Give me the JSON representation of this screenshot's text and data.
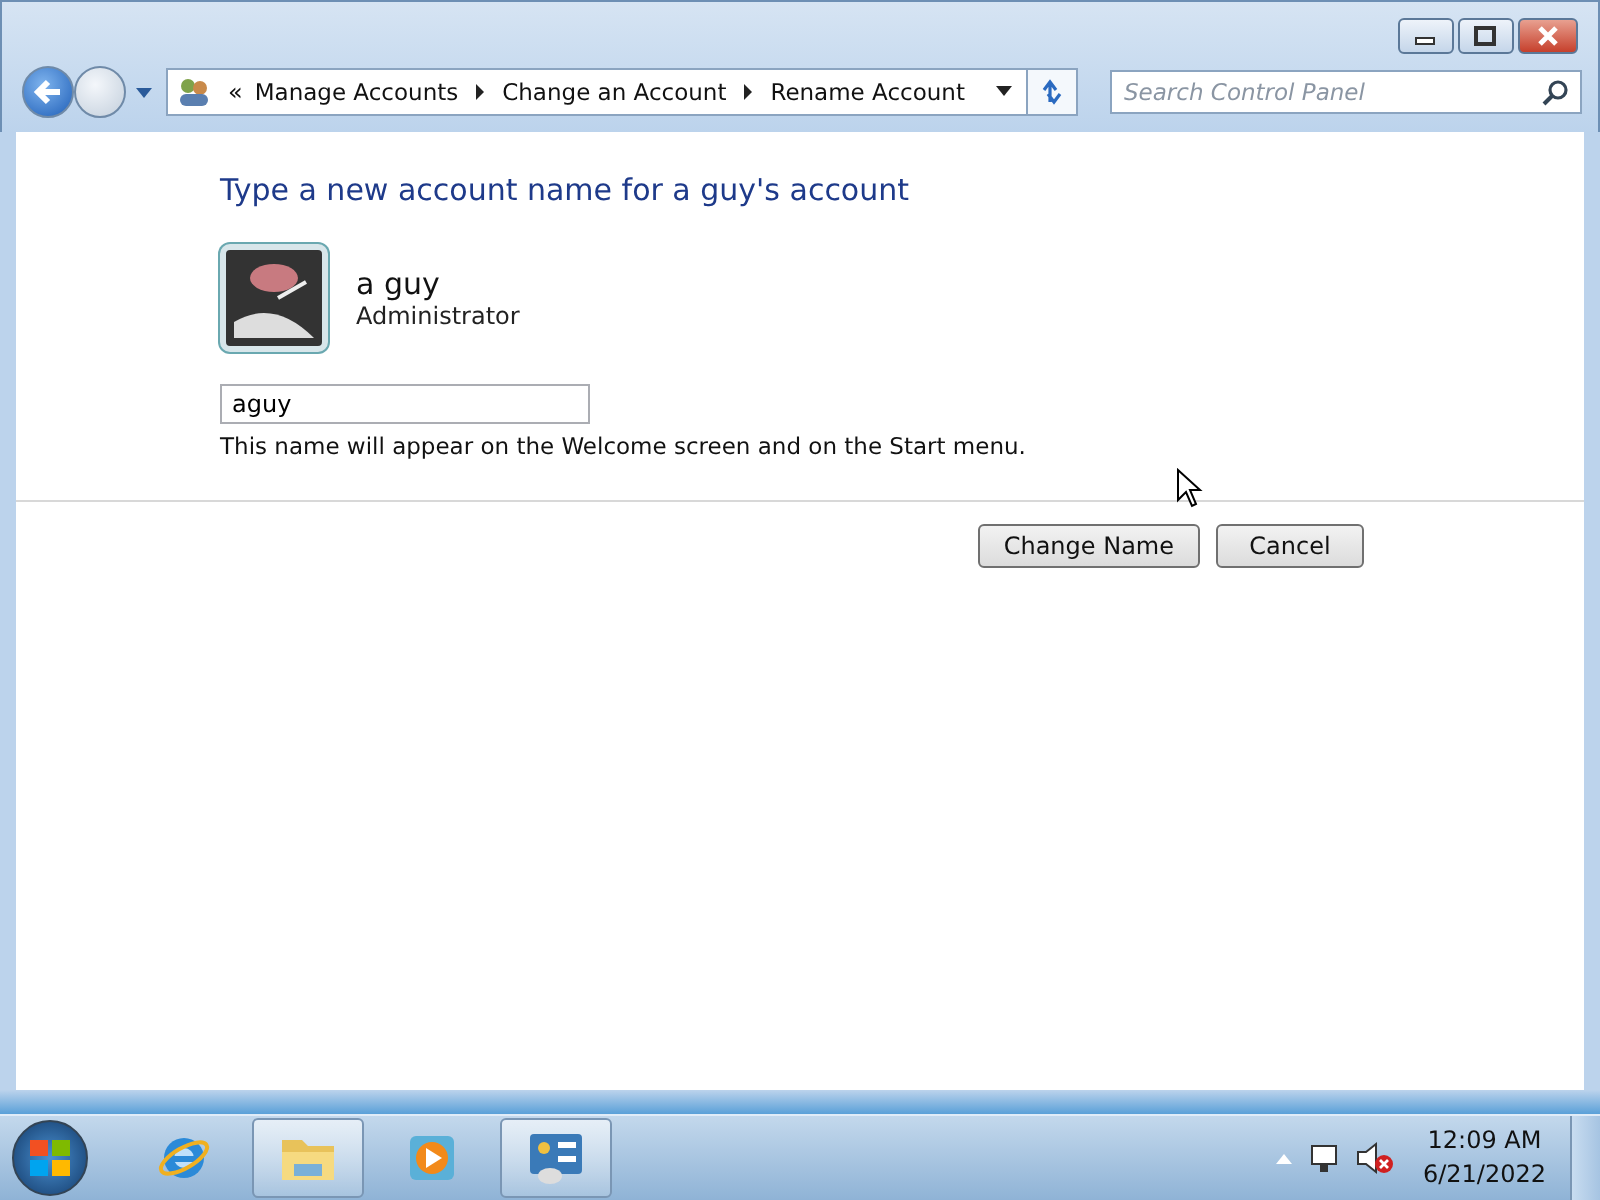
{
  "address_bar": {
    "overflow": "«",
    "crumbs": [
      "Manage Accounts",
      "Change an Account",
      "Rename Account"
    ]
  },
  "search": {
    "placeholder": "Search Control Panel"
  },
  "heading": "Type a new account name for a guy's account",
  "account": {
    "name": "a guy",
    "role": "Administrator"
  },
  "name_field": {
    "value": "aguy"
  },
  "hint": "This name will appear on the Welcome screen and on the Start menu.",
  "buttons": [
    "Change Name",
    "Cancel"
  ],
  "taskbar": {
    "items": [
      {
        "kind": "browser",
        "running": false
      },
      {
        "kind": "folder",
        "running": true
      },
      {
        "kind": "media",
        "running": false
      },
      {
        "kind": "control",
        "running": true
      }
    ],
    "time": "12:09 AM",
    "date": "6/21/2022"
  }
}
